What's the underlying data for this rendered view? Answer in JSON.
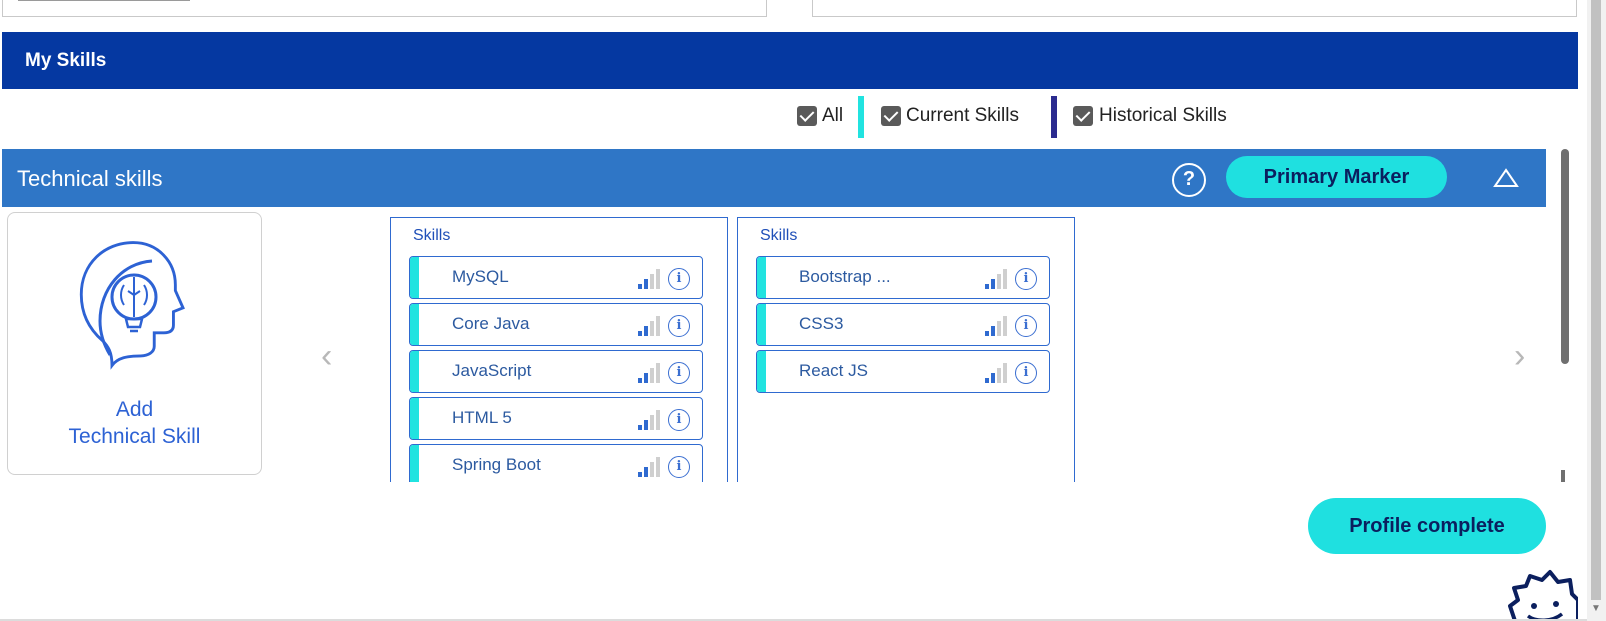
{
  "section": {
    "title": "My Skills"
  },
  "filters": [
    {
      "label": "All",
      "checked": true
    },
    {
      "label": "Current Skills",
      "checked": true,
      "marker_color": "#21e3e0"
    },
    {
      "label": "Historical Skills",
      "checked": true,
      "marker_color": "#2b2b8f"
    }
  ],
  "technical": {
    "title": "Technical skills",
    "help_symbol": "?",
    "primary_marker_label": "Primary Marker",
    "add_label_line1": "Add",
    "add_label_line2": "Technical Skill",
    "columns": [
      {
        "title": "Skills",
        "skills": [
          "MySQL",
          "Core Java",
          "JavaScript",
          "HTML 5",
          "Spring Boot"
        ]
      },
      {
        "title": "Skills",
        "skills": [
          "Bootstrap ...",
          "CSS3",
          "React JS"
        ]
      }
    ],
    "prev_arrow": "‹",
    "next_arrow": "›"
  },
  "profile_button": "Profile complete",
  "icons": {
    "help": "help-circle-icon",
    "collapse": "chevron-up-icon",
    "signal": "signal-strength-icon",
    "info": "info-icon",
    "add": "brain-head-icon",
    "bot": "chatbot-icon"
  },
  "colors": {
    "header": "#0538a1",
    "tech_bar": "#2f76c6",
    "accent": "#1fe0e0",
    "current_marker": "#21e3e0",
    "historical_marker": "#2b2b8f"
  }
}
